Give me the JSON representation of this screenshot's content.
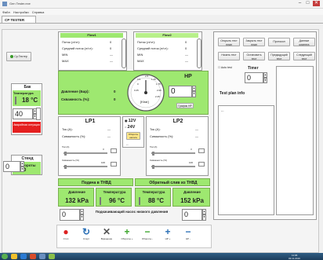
{
  "window": {
    "title": "Gen Tester.exe",
    "minimize": "–",
    "maximize": "□",
    "close": "✕"
  },
  "menu": [
    "Файл",
    "Настройки",
    "Справка"
  ],
  "tab": "CP TESTER",
  "left": {
    "button": "Ср.Тестер",
    "bak_title": "Бак",
    "temp_label": "Температура",
    "temp_value": "18 °C",
    "level_value": "40",
    "alarm": "Аварийная ситуация",
    "stand_title": "Стенд",
    "rpm_label": "Обороты",
    "rpm_value": "0",
    "num_value": "0"
  },
  "flow1": {
    "title": "Flow1",
    "rows": [
      {
        "label": "Поток (л/чт):",
        "value": "0"
      },
      {
        "label": "Средний поток (л/чт):",
        "value": "0"
      },
      {
        "label": "MIN",
        "value": "—"
      },
      {
        "label": "MAX",
        "value": "—"
      }
    ]
  },
  "flow2": {
    "title": "Flow2",
    "rows": [
      {
        "label": "Поток (л/чт):",
        "value": "0"
      },
      {
        "label": "Средний поток (л/чт):",
        "value": "0"
      },
      {
        "label": "MIN",
        "value": "—"
      },
      {
        "label": "MAX",
        "value": "—"
      }
    ]
  },
  "hp": {
    "pressure_label": "Давление (Бар):",
    "pressure_value": "0",
    "speed_label": "Скважность (%):",
    "speed_value": "0",
    "gauge_unit": "[Kbar]",
    "gauge_ticks": [
      "0",
      "0.25",
      "0.5",
      "1.25",
      "1.75",
      "2.00",
      "2.25",
      "2.5"
    ],
    "title": "HP",
    "hp_value": "0",
    "hp_button": "График HP"
  },
  "lp1": {
    "title": "LP1",
    "tok_label": "Ток (A):",
    "tok_value": "—",
    "skv_label": "Скважность (%):",
    "skv_value": "—",
    "tok_small": "Ток (A)",
    "skv_small": "Скважность (%)",
    "slider1_max": "3",
    "slider2_max": "100"
  },
  "lp2": {
    "title": "LP2",
    "tok_label": "Ток (A):",
    "tok_value": "—",
    "skv_label": "Скважность (%):",
    "skv_value": "—",
    "tok_small": "Ток (A)",
    "skv_small": "Скважность (%)",
    "slider1_max": "3",
    "slider2_max": "100"
  },
  "voltage": {
    "v12": "12V",
    "v24": "24V",
    "btn": "Обороты насоса",
    "dash": "--"
  },
  "buttons_right": [
    [
      "Открыть тест план",
      "Закрыть тест план",
      "Протокол",
      "Данные клиента"
    ],
    [
      "Начать тест",
      "Остановить тест",
      "Предыдущий тест",
      "Следующий тест"
    ]
  ],
  "autotest": "Auto test",
  "timer_label": "Timer",
  "timer_value": "0",
  "testplan": "Test plan info",
  "testplan_content": "---",
  "feed": {
    "title": "Подача в ТНВД",
    "p_label": "Давление",
    "p_value": "132 kPa",
    "t_label": "Температура",
    "t_value": "96 °C"
  },
  "ret": {
    "title": "Обратный слив из ТНВД",
    "t_label": "Температура",
    "t_value": "88 °C",
    "p_label": "Давление",
    "p_value": "152 kPa"
  },
  "pump_value": "0",
  "pump_label": "Подкачивающий насос низкого давления",
  "pump_value2": "0",
  "toolbar": [
    {
      "icon": "stop-icon",
      "label": "Стоп"
    },
    {
      "icon": "rotate-icon",
      "label": "Старт"
    },
    {
      "icon": "tools-icon",
      "label": "Вращение"
    },
    {
      "icon": "plus-icon",
      "label": "Обороты +"
    },
    {
      "icon": "minus-icon",
      "label": "Обороты -"
    },
    {
      "icon": "plus-blue-icon",
      "label": "HP +"
    },
    {
      "icon": "minus-blue-icon",
      "label": "HP -"
    }
  ],
  "colors": {
    "green": "#9ee870",
    "red": "#e52020",
    "taskbar": "#1c3d5c"
  },
  "taskbar": {
    "time": "11:06",
    "date": "03.11.2016"
  }
}
